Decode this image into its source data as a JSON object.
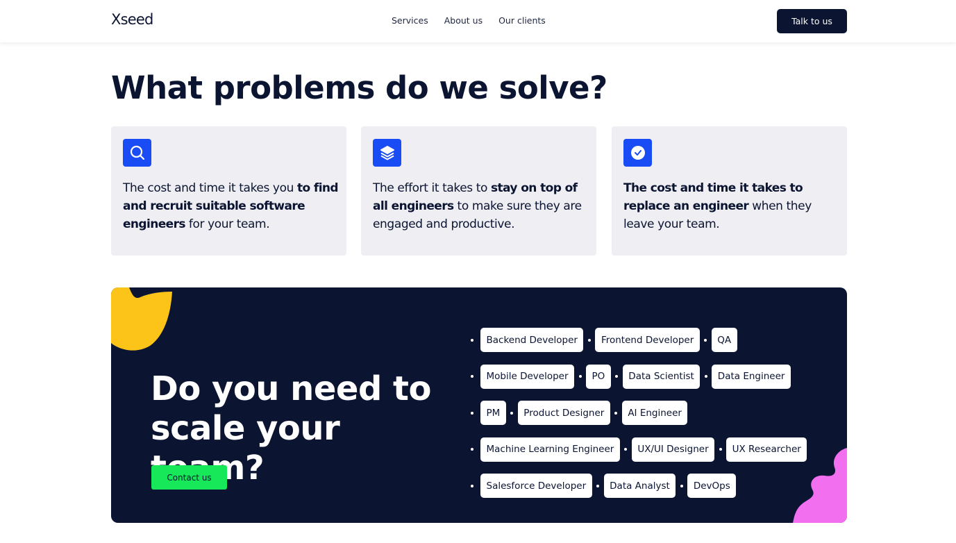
{
  "header": {
    "logo": "Xseed",
    "nav": [
      {
        "label": "Services"
      },
      {
        "label": "About us"
      },
      {
        "label": "Our clients"
      }
    ],
    "cta_label": "Talk to us"
  },
  "problems": {
    "title": "What problems do we solve?",
    "cards": [
      {
        "icon": "search-icon",
        "text_before": "The cost and time it takes you ",
        "text_bold": "to find and recruit suitable software engineers",
        "text_after": " for your team."
      },
      {
        "icon": "layers-icon",
        "text_before": "The effort it takes to ",
        "text_bold": "stay on top of all engineers",
        "text_after": " to make sure they are engaged and productive."
      },
      {
        "icon": "clock-icon",
        "text_before": "",
        "text_bold": "The cost and time it takes to replace an engineer",
        "text_after": " when they leave your team."
      }
    ]
  },
  "scale": {
    "title": "Do you need to scale your team?",
    "contact_label": "Contact us",
    "tag_rows": [
      [
        "Backend Developer",
        "Frontend Developer",
        "QA"
      ],
      [
        "Mobile Developer",
        "PO",
        "Data Scientist",
        "Data Engineer"
      ],
      [
        "PM",
        "Product Designer",
        "AI Engineer"
      ],
      [
        "Machine Learning Engineer",
        "UX/UI Designer",
        "UX Researcher"
      ],
      [
        "Salesforce Developer",
        "Data Analyst",
        "DevOps"
      ]
    ]
  },
  "colors": {
    "navy": "#0b1431",
    "accent_blue": "#1a4cf5",
    "accent_green": "#16e85a",
    "accent_yellow": "#fcc419",
    "accent_pink": "#f26ff0",
    "card_bg": "#eeeef3"
  }
}
